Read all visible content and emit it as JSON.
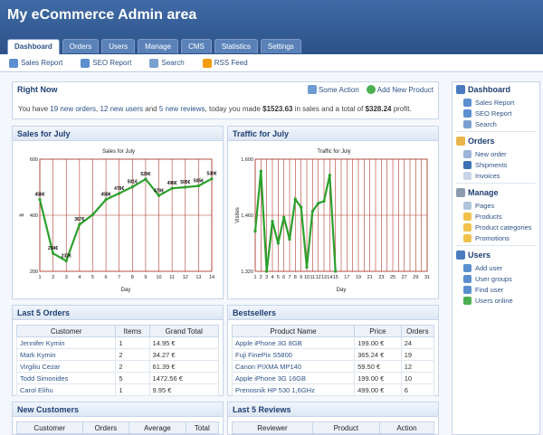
{
  "app": {
    "title": "My eCommerce Admin area"
  },
  "tabs": [
    "Dashboard",
    "Orders",
    "Users",
    "Manage",
    "CMS",
    "Statistics",
    "Settings"
  ],
  "subnav": [
    {
      "label": "Sales Report",
      "icon": "report-icon"
    },
    {
      "label": "SEO Report",
      "icon": "report-icon"
    },
    {
      "label": "Search",
      "icon": "search-icon"
    },
    {
      "label": "RSS Feed",
      "icon": "rss-icon"
    }
  ],
  "right_now": {
    "title": "Right Now",
    "actions": [
      "Some Action",
      "Add New Product"
    ],
    "text_prefix": "You have ",
    "orders": "19 new orders",
    "sep1": ", ",
    "users": "12 new users",
    "sep2": " and ",
    "reviews": "5 new reviews",
    "sep3": ", today you made ",
    "sales": "$1523.63",
    "sep4": " in sales and a total of ",
    "profit": "$328.24",
    "suffix": " profit."
  },
  "sales_panel": {
    "title": "Sales for July"
  },
  "traffic_panel": {
    "title": "Traffic for July"
  },
  "chart_data": [
    {
      "type": "line",
      "title": "Sales for July",
      "xlabel": "Day",
      "ylabel": "$",
      "x": [
        1,
        2,
        3,
        4,
        5,
        6,
        7,
        8,
        9,
        10,
        11,
        12,
        13,
        14
      ],
      "y": [
        456,
        264,
        237,
        367,
        402,
        456,
        478,
        501,
        529,
        470,
        496,
        500,
        505,
        530
      ],
      "labels": [
        "456€",
        "264€",
        "237€",
        "367€",
        "",
        "458€",
        "478€",
        "501€",
        "529€",
        "470€",
        "496€",
        "505€",
        "505€",
        "530€"
      ],
      "xlim": [
        1,
        14
      ],
      "ylim": [
        200,
        600
      ],
      "yticks": [
        200,
        400,
        600
      ],
      "color": "#2ca02c",
      "grid": true
    },
    {
      "type": "line",
      "title": "Traffic for July",
      "xlabel": "Day",
      "ylabel": "Visites",
      "x": [
        1,
        2,
        3,
        4,
        5,
        6,
        7,
        8,
        9,
        10,
        11,
        12,
        13,
        14,
        15
      ],
      "y": [
        1420,
        1570,
        1320,
        1445,
        1390,
        1455,
        1400,
        1500,
        1480,
        1330,
        1470,
        1490,
        1495,
        1560,
        1320
      ],
      "xticklabels": [
        "1",
        "2",
        "3",
        "4",
        "5",
        "6",
        "7",
        "8",
        "9",
        "10",
        "11",
        "12",
        "13",
        "14",
        "15",
        "17",
        "19",
        "21",
        "23",
        "25",
        "27",
        "29",
        "31"
      ],
      "xlim": [
        1,
        31
      ],
      "ylim": [
        1320,
        1600
      ],
      "yticks": [
        1320,
        1460,
        1600
      ],
      "yticklabels": [
        "1,320",
        "1,460",
        "1,600"
      ],
      "color": "#2ca02c",
      "grid": true
    }
  ],
  "last_orders": {
    "title": "Last 5 Orders",
    "columns": [
      "Customer",
      "Items",
      "Grand Total"
    ],
    "rows": [
      [
        "Jennifer Kymin",
        "1",
        "14.95 €"
      ],
      [
        "Mark Kymin",
        "2",
        "34.27 €"
      ],
      [
        "Virgiliu Cezar",
        "2",
        "61.39 €"
      ],
      [
        "Todd Simonides",
        "5",
        "1472.56 €"
      ],
      [
        "Carol Elihu",
        "1",
        "9.95 €"
      ]
    ]
  },
  "bestsellers": {
    "title": "Bestsellers",
    "columns": [
      "Product Name",
      "Price",
      "Orders"
    ],
    "rows": [
      [
        "Apple iPhone 3G 8GB",
        "199.00 €",
        "24"
      ],
      [
        "Fuji FinePix S5800",
        "365.24 €",
        "19"
      ],
      [
        "Canon PIXMA MP140",
        "59.50 €",
        "12"
      ],
      [
        "Apple iPhone 3G 16GB",
        "199.00 €",
        "10"
      ],
      [
        "Prenosnik HP 530 1,6GHz",
        "499.00 €",
        "6"
      ]
    ]
  },
  "new_customers": {
    "title": "New Customers",
    "columns": [
      "Customer",
      "Orders",
      "Average",
      "Total"
    ]
  },
  "last_reviews": {
    "title": "Last 5 Reviews",
    "columns": [
      "Reviewer",
      "Product",
      "Action"
    ]
  },
  "sidebar": [
    {
      "head": "Dashboard",
      "icon": "home-icon",
      "items": [
        {
          "label": "Sales Report",
          "icon": "report-icon"
        },
        {
          "label": "SEO Report",
          "icon": "report-icon"
        },
        {
          "label": "Search",
          "icon": "search-icon"
        }
      ]
    },
    {
      "head": "Orders",
      "icon": "orders-icon",
      "items": [
        {
          "label": "New order",
          "icon": "new-order-icon"
        },
        {
          "label": "Shipments",
          "icon": "truck-icon"
        },
        {
          "label": "Invoices",
          "icon": "invoice-icon"
        }
      ]
    },
    {
      "head": "Manage",
      "icon": "gear-icon",
      "items": [
        {
          "label": "Pages",
          "icon": "page-icon"
        },
        {
          "label": "Products",
          "icon": "folder-icon"
        },
        {
          "label": "Product categories",
          "icon": "folder-icon"
        },
        {
          "label": "Promotions",
          "icon": "folder-icon"
        }
      ]
    },
    {
      "head": "Users",
      "icon": "users-icon",
      "items": [
        {
          "label": "Add user",
          "icon": "add-user-icon"
        },
        {
          "label": "User groups",
          "icon": "group-icon"
        },
        {
          "label": "Find user",
          "icon": "find-user-icon"
        },
        {
          "label": "Users online",
          "icon": "online-icon"
        }
      ]
    }
  ]
}
